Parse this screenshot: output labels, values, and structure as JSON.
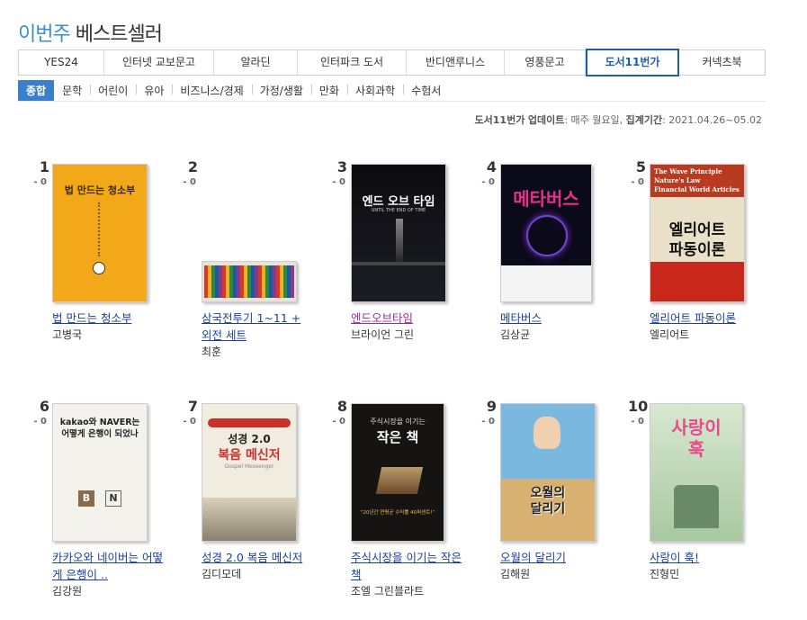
{
  "header": {
    "accent": "이번주",
    "main": "베스트셀러"
  },
  "store_tabs": [
    {
      "label": "YES24",
      "active": false
    },
    {
      "label": "인터넷 교보문고",
      "active": false
    },
    {
      "label": "알라딘",
      "active": false
    },
    {
      "label": "인터파크 도서",
      "active": false
    },
    {
      "label": "반디앤루니스",
      "active": false
    },
    {
      "label": "영풍문고",
      "active": false
    },
    {
      "label": "도서11번가",
      "active": true
    },
    {
      "label": "커넥츠북",
      "active": false
    }
  ],
  "categories": [
    "종합",
    "문학",
    "어린이",
    "유아",
    "비즈니스/경제",
    "가정/생활",
    "만화",
    "사회과학",
    "수험서"
  ],
  "update": {
    "store": "도서11번가",
    "label1": "업데이트",
    "value1": ": 매주 월요일, ",
    "label2": "집계기간",
    "value2": ": 2021.04.26~05.02"
  },
  "books": [
    {
      "rank": "1",
      "change": "- 0",
      "title": "법 만드는 청소부",
      "author": "고병국"
    },
    {
      "rank": "2",
      "change": "- 0",
      "title": "삼국전투기 1~11 + 외전 세트",
      "author": "최훈"
    },
    {
      "rank": "3",
      "change": "- 0",
      "title": "엔드오브타임",
      "author": "브라이언 그린"
    },
    {
      "rank": "4",
      "change": "- 0",
      "title": "메타버스",
      "author": "김상균"
    },
    {
      "rank": "5",
      "change": "- 0",
      "title": "엘리어트 파동이론",
      "author": "엘리어트"
    },
    {
      "rank": "6",
      "change": "- 0",
      "title": "카카오와 네이버는 어떻게 은행이 ..",
      "author": "김강원"
    },
    {
      "rank": "7",
      "change": "- 0",
      "title": "성경 2.0 복음 메신저",
      "author": "김디모데"
    },
    {
      "rank": "8",
      "change": "- 0",
      "title": "주식시장을 이기는 작은 책",
      "author": "조엘 그린블라트"
    },
    {
      "rank": "9",
      "change": "- 0",
      "title": "오월의 달리기",
      "author": "김해원"
    },
    {
      "rank": "10",
      "change": "- 0",
      "title": "사랑이 훅!",
      "author": "진형민"
    }
  ],
  "covers": {
    "c1": "법 만드는 청소부",
    "c3": "엔드 오브 타임",
    "c3b": "UNTIL THE END OF TIME",
    "c4": "메타버스",
    "c5a": "The Wave Principle",
    "c5b": "Nature's Law",
    "c5c": "Financial World Articles",
    "c5d": "엘리어트",
    "c5e": "파동이론",
    "c6a": "kakao와 NAVER는",
    "c6b": "어떻게 은행이 되었나",
    "c6c": "B",
    "c6d": "N",
    "c7a": "성경",
    "c7b": "2.0",
    "c7c": "복음 메신저",
    "c7d": "Gospel Messenger",
    "c8a": "주식시장을 이기는",
    "c8b": "작은 책",
    "c8c": "\"20년간 연평균 수익률 40퍼센트!\"",
    "c9a": "오월의",
    "c9b": "달리기",
    "c10": "사랑이 훅"
  },
  "colors": {
    "accent": "#3a8ed0",
    "link": "#1b3f9e",
    "visited": "#a02a9a",
    "active_tab": "#1a5fa8",
    "active_cat": "#3a7fc9"
  }
}
